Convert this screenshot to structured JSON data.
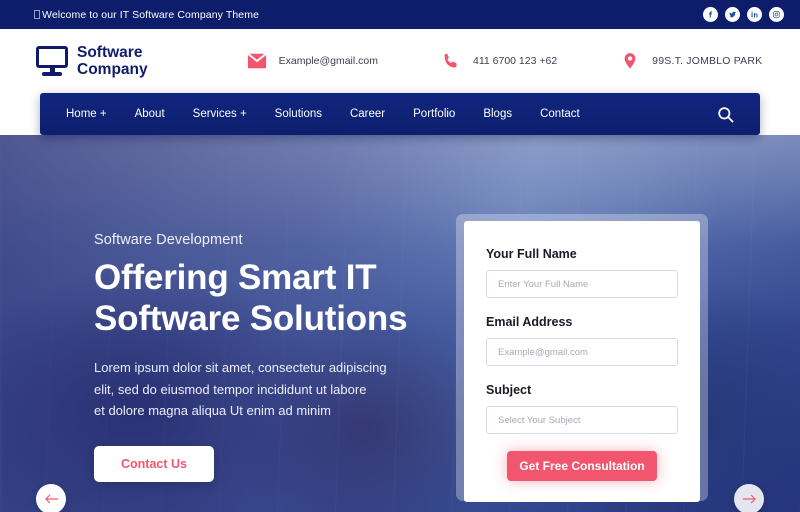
{
  "topbar": {
    "welcome_text": "Welcome to our IT Software Company Theme",
    "socials": [
      {
        "name": "facebook-icon",
        "label": "Facebook"
      },
      {
        "name": "twitter-icon",
        "label": "Twitter"
      },
      {
        "name": "linkedin-icon",
        "label": "LinkedIn"
      },
      {
        "name": "instagram-icon",
        "label": "Instagram"
      }
    ],
    "bg_color": "#0d1d6b"
  },
  "header": {
    "brand_line1": "Software",
    "brand_line2": "Company",
    "brand_color": "#101b6b",
    "contacts": [
      {
        "icon": "email-icon",
        "value": "Example@gmail.com"
      },
      {
        "icon": "phone-icon",
        "value": "411 6700 123 +62"
      },
      {
        "icon": "location-pin-icon",
        "value": "99S.T. JOMBLO PARK"
      }
    ],
    "accent_color": "#f2566e"
  },
  "nav": {
    "items": [
      {
        "label": "Home +"
      },
      {
        "label": "About"
      },
      {
        "label": "Services +"
      },
      {
        "label": "Solutions"
      },
      {
        "label": "Career"
      },
      {
        "label": "Portfolio"
      },
      {
        "label": "Blogs"
      },
      {
        "label": "Contact"
      }
    ],
    "search_icon": "search-icon",
    "bg_color": "#10257f"
  },
  "hero": {
    "subtitle": "Software Development",
    "title_line1": "Offering Smart IT",
    "title_line2": "Software Solutions",
    "body_line1": "Lorem ipsum dolor sit amet, consectetur adipiscing",
    "body_line2": "elit, sed do eiusmod tempor incididunt ut labore",
    "body_line3": "et dolore magna aliqua Ut enim ad minim",
    "cta_label": "Contact Us",
    "prev_arrow": "arrow-left-icon",
    "next_arrow": "arrow-right-icon"
  },
  "form": {
    "fields": [
      {
        "label": "Your Full Name",
        "placeholder": "Enter Your Full Name"
      },
      {
        "label": "Email Address",
        "placeholder": "Example@gmail.com"
      },
      {
        "label": "Subject",
        "placeholder": "Select Your Subject"
      }
    ],
    "submit_label": "Get Free Consultation",
    "submit_color": "#f2566e"
  }
}
